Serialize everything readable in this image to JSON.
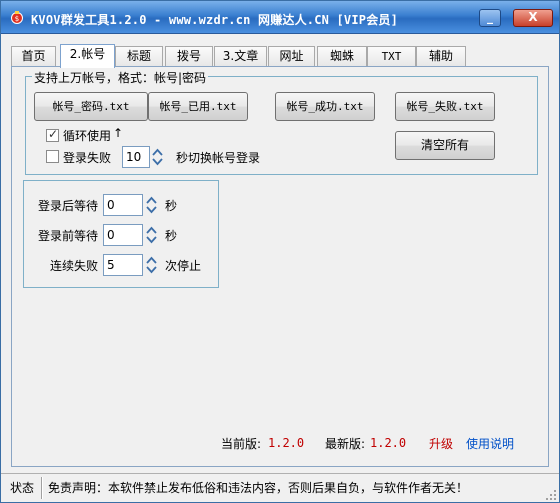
{
  "window": {
    "title": "KVOV群发工具1.2.0 - www.wzdr.cn 网赚达人.CN [VIP会员]",
    "minimize_label": "_",
    "close_label": "X"
  },
  "tabs": [
    {
      "label": "首页"
    },
    {
      "label": "2.帐号"
    },
    {
      "label": "标题"
    },
    {
      "label": "拨号"
    },
    {
      "label": "3.文章"
    },
    {
      "label": "网址"
    },
    {
      "label": "蜘蛛"
    },
    {
      "label": "TXT"
    },
    {
      "label": "辅助"
    }
  ],
  "accounts_group": {
    "title": "支持上万帐号，格式：帐号|密码",
    "buttons": {
      "password_txt": "帐号_密码.txt",
      "used_txt": "帐号_已用.txt",
      "success_txt": "帐号_成功.txt",
      "fail_txt": "帐号_失败.txt",
      "clear_all": "清空所有"
    },
    "loop_use": {
      "label": "循环使用",
      "checked": true,
      "arrow": "↑"
    },
    "login_fail": {
      "label": "登录失败",
      "checked": false,
      "value": "10",
      "suffix": "秒切换帐号登录"
    }
  },
  "wait_group": {
    "after_login": {
      "label": "登录后等待",
      "value": "0",
      "unit": "秒"
    },
    "before_login": {
      "label": "登录前等待",
      "value": "0",
      "unit": "秒"
    },
    "consecutive_fail": {
      "label": "连续失败",
      "value": "5",
      "unit": "次停止"
    }
  },
  "version": {
    "current_label": "当前版:",
    "current_value": "1.2.0",
    "latest_label": "最新版:",
    "latest_value": "1.2.0",
    "upgrade": "升级",
    "help": "使用说明"
  },
  "statusbar": {
    "status": "状态",
    "disclaimer": "免责声明：本软件禁止发布低俗和违法内容，否则后果自负，与软件作者无关！"
  },
  "colors": {
    "title_blue": "#3a7fd0",
    "group_border": "#7fb0c8",
    "version_red": "#c00000",
    "link_blue": "#0050c8"
  }
}
